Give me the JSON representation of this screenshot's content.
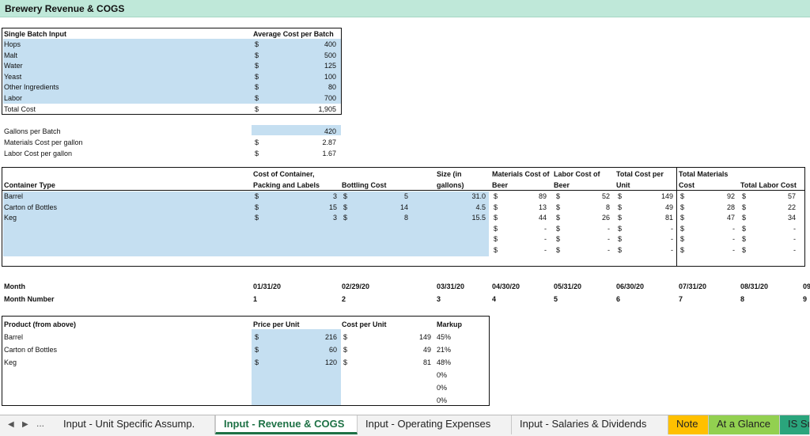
{
  "title": "Brewery Revenue & COGS",
  "batch": {
    "header_label": "Single Batch Input",
    "header_cost": "Average Cost per Batch",
    "items": [
      {
        "label": "Hops",
        "cur": "$",
        "value": "400"
      },
      {
        "label": "Malt",
        "cur": "$",
        "value": "500"
      },
      {
        "label": "Water",
        "cur": "$",
        "value": "125"
      },
      {
        "label": "Yeast",
        "cur": "$",
        "value": "100"
      },
      {
        "label": "Other Ingredients",
        "cur": "$",
        "value": "80"
      },
      {
        "label": "Labor",
        "cur": "$",
        "value": "700"
      }
    ],
    "total": {
      "label": "Total Cost",
      "cur": "$",
      "value": "1,905"
    }
  },
  "gallons": {
    "rows": [
      {
        "label": "Gallons per Batch",
        "cur": "",
        "value": "420"
      },
      {
        "label": "Materials Cost per gallon",
        "cur": "$",
        "value": "2.87"
      },
      {
        "label": "Labor Cost per gallon",
        "cur": "$",
        "value": "1.67"
      }
    ]
  },
  "container": {
    "headers": {
      "type": "Container Type",
      "packing1": "Cost of Container,",
      "packing2": "Packing and Labels",
      "bottling": "Bottling Cost",
      "size1": "Size (in",
      "size2": "gallons)",
      "mat1": "Materials Cost of",
      "mat2": "Beer",
      "lab1": "Labor Cost of",
      "lab2": "Beer",
      "tcu1": "Total Cost per",
      "tcu2": "Unit",
      "tmc1": "Total Materials",
      "tmc2": "Cost",
      "tlc": "Total Labor Cost"
    },
    "rows": [
      {
        "type": "Barrel",
        "packing": "3",
        "bottling": "5",
        "size": "31.0",
        "mat": "89",
        "lab": "52",
        "tcu": "149",
        "tmc": "92",
        "tlc": "57"
      },
      {
        "type": "Carton of Bottles",
        "packing": "15",
        "bottling": "14",
        "size": "4.5",
        "mat": "13",
        "lab": "8",
        "tcu": "49",
        "tmc": "28",
        "tlc": "22"
      },
      {
        "type": "Keg",
        "packing": "3",
        "bottling": "8",
        "size": "15.5",
        "mat": "44",
        "lab": "26",
        "tcu": "81",
        "tmc": "47",
        "tlc": "34"
      },
      {
        "type": "",
        "packing": "",
        "bottling": "",
        "size": "",
        "mat": "-",
        "lab": "-",
        "tcu": "-",
        "tmc": "-",
        "tlc": "-"
      },
      {
        "type": "",
        "packing": "",
        "bottling": "",
        "size": "",
        "mat": "-",
        "lab": "-",
        "tcu": "-",
        "tmc": "-",
        "tlc": "-"
      },
      {
        "type": "",
        "packing": "",
        "bottling": "",
        "size": "",
        "mat": "-",
        "lab": "-",
        "tcu": "-",
        "tmc": "-",
        "tlc": "-"
      }
    ]
  },
  "months": {
    "month_label": "Month",
    "number_label": "Month Number",
    "dates": [
      "01/31/20",
      "02/29/20",
      "03/31/20",
      "04/30/20",
      "05/31/20",
      "06/30/20",
      "07/31/20",
      "08/31/20",
      "09"
    ],
    "numbers": [
      "1",
      "2",
      "3",
      "4",
      "5",
      "6",
      "7",
      "8",
      "9"
    ]
  },
  "product": {
    "headers": {
      "product": "Product (from above)",
      "price": "Price per Unit",
      "cost": "Cost per Unit",
      "markup": "Markup"
    },
    "rows": [
      {
        "product": "Barrel",
        "price": "216",
        "cost": "149",
        "markup": "45%"
      },
      {
        "product": "Carton of Bottles",
        "price": "60",
        "cost": "49",
        "markup": "21%"
      },
      {
        "product": "Keg",
        "price": "120",
        "cost": "81",
        "markup": "48%"
      },
      {
        "product": "",
        "price": "",
        "cost": "",
        "markup": "0%"
      },
      {
        "product": "",
        "price": "",
        "cost": "",
        "markup": "0%"
      },
      {
        "product": "",
        "price": "",
        "cost": "",
        "markup": "0%"
      }
    ]
  },
  "currency": "$",
  "tabs": {
    "ellipsis": "...",
    "items": [
      {
        "label": "Input - Unit Specific Assump.",
        "kind": "normal"
      },
      {
        "label": "Input - Revenue & COGS",
        "kind": "active"
      },
      {
        "label": "Input - Operating Expenses",
        "kind": "normal"
      },
      {
        "label": "Input - Salaries & Dividends",
        "kind": "normal"
      },
      {
        "label": "Note",
        "kind": "note"
      },
      {
        "label": "At a Glance",
        "kind": "glance"
      },
      {
        "label": "IS Su",
        "kind": "is"
      }
    ]
  },
  "colors": {
    "input_fill": "#c5dff1",
    "title_fill": "#bfe8d9",
    "active_tab": "#1e7145"
  }
}
